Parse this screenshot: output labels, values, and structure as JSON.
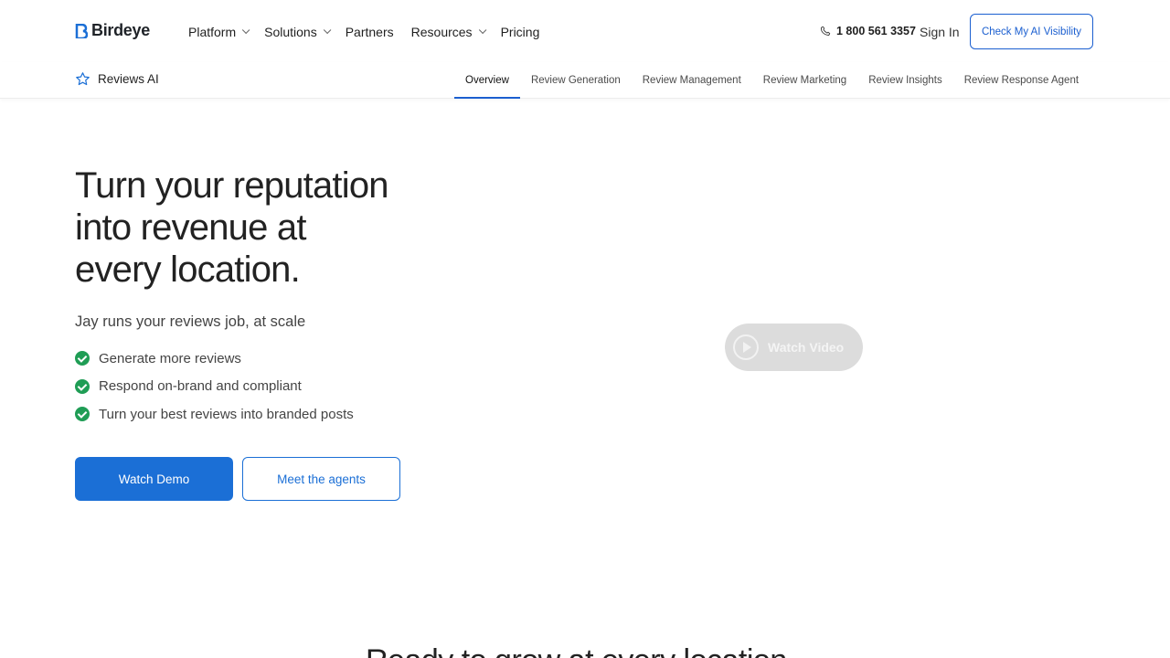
{
  "brand": {
    "name": "Birdeye",
    "accent": "#1b6fd6"
  },
  "nav": {
    "items": [
      {
        "label": "Platform",
        "has_dropdown": true
      },
      {
        "label": "Solutions",
        "has_dropdown": true
      },
      {
        "label": "Partners",
        "has_dropdown": false
      },
      {
        "label": "Resources",
        "has_dropdown": true
      },
      {
        "label": "Pricing",
        "has_dropdown": false
      }
    ],
    "phone": "1 800 561 3357",
    "signin": "Sign In",
    "cta": "Check My AI Visibility"
  },
  "subnav": {
    "product": "Reviews AI",
    "tabs": [
      {
        "label": "Overview",
        "active": true
      },
      {
        "label": "Review Generation",
        "active": false
      },
      {
        "label": "Review Management",
        "active": false
      },
      {
        "label": "Review Marketing",
        "active": false
      },
      {
        "label": "Review Insights",
        "active": false
      },
      {
        "label": "Review Response Agent",
        "active": false
      }
    ]
  },
  "hero": {
    "title_lines": [
      "Turn your reputation",
      "into revenue at",
      "every location."
    ],
    "subtitle": "Jay runs your reviews job, at scale",
    "bullets": [
      "Generate more reviews",
      "Respond on-brand and compliant",
      "Turn your best reviews into branded posts"
    ],
    "primary_button": "Watch Demo",
    "secondary_button": "Meet the agents",
    "video_button": "Watch Video"
  },
  "next_section": {
    "heading_partial": "Ready to grow at every location"
  }
}
